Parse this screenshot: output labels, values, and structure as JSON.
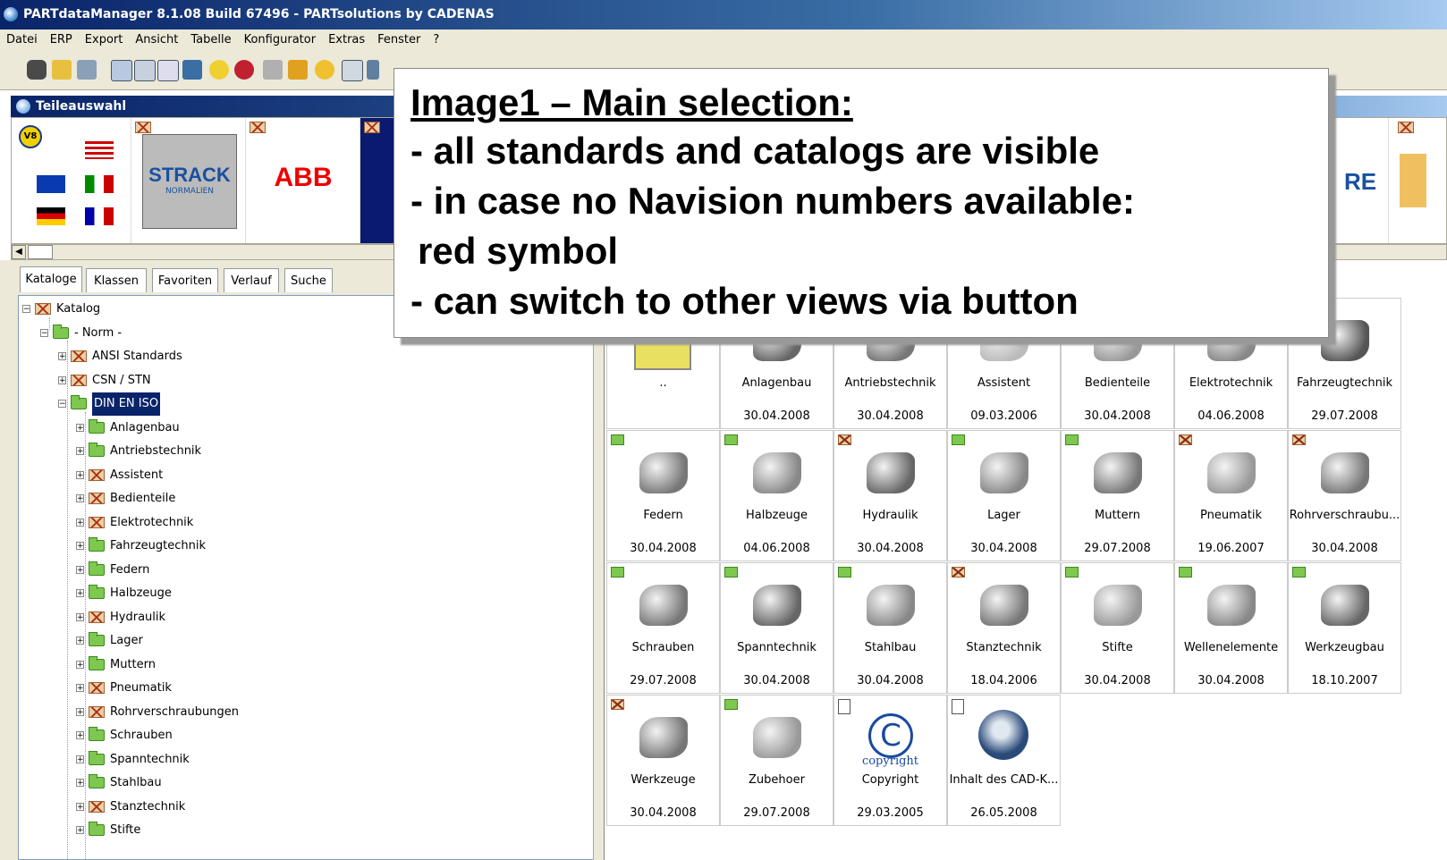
{
  "window": {
    "title": "PARTdataManager 8.1.08 Build 67496 - PARTsolutions by CADENAS"
  },
  "menu": [
    "Datei",
    "ERP",
    "Export",
    "Ansicht",
    "Tabelle",
    "Konfigurator",
    "Extras",
    "Fenster",
    "?"
  ],
  "panel": {
    "title": "Teileauswahl"
  },
  "logos": {
    "strack": "STRACK",
    "strack_sub": "NORMALIEN",
    "abb": "ABB",
    "partial_right": "RE"
  },
  "tabs": [
    "Kataloge",
    "Klassen",
    "Favoriten",
    "Verlauf",
    "Suche"
  ],
  "tree": [
    {
      "label": "Katalog",
      "icon": "red"
    },
    {
      "label": "- Norm -",
      "icon": "green"
    },
    {
      "label": "ANSI Standards",
      "icon": "red"
    },
    {
      "label": "CSN / STN",
      "icon": "red"
    },
    {
      "label": "DIN EN ISO",
      "icon": "green",
      "selected": true
    },
    {
      "label": "Anlagenbau",
      "icon": "green"
    },
    {
      "label": "Antriebstechnik",
      "icon": "green"
    },
    {
      "label": "Assistent",
      "icon": "red"
    },
    {
      "label": "Bedienteile",
      "icon": "red"
    },
    {
      "label": "Elektrotechnik",
      "icon": "red"
    },
    {
      "label": "Fahrzeugtechnik",
      "icon": "green"
    },
    {
      "label": "Federn",
      "icon": "green"
    },
    {
      "label": "Halbzeuge",
      "icon": "green"
    },
    {
      "label": "Hydraulik",
      "icon": "red"
    },
    {
      "label": "Lager",
      "icon": "green"
    },
    {
      "label": "Muttern",
      "icon": "green"
    },
    {
      "label": "Pneumatik",
      "icon": "red"
    },
    {
      "label": "Rohrverschraubungen",
      "icon": "red"
    },
    {
      "label": "Schrauben",
      "icon": "green"
    },
    {
      "label": "Spanntechnik",
      "icon": "green"
    },
    {
      "label": "Stahlbau",
      "icon": "green"
    },
    {
      "label": "Stanztechnik",
      "icon": "red"
    },
    {
      "label": "Stifte",
      "icon": "green"
    }
  ],
  "grid": [
    {
      "name": "..",
      "date": "",
      "badge": "none"
    },
    {
      "name": "Anlagenbau",
      "date": "30.04.2008",
      "badge": "none"
    },
    {
      "name": "Antriebstechnik",
      "date": "30.04.2008",
      "badge": "none"
    },
    {
      "name": "Assistent",
      "date": "09.03.2006",
      "badge": "none"
    },
    {
      "name": "Bedienteile",
      "date": "30.04.2008",
      "badge": "none"
    },
    {
      "name": "Elektrotechnik",
      "date": "04.06.2008",
      "badge": "none"
    },
    {
      "name": "Fahrzeugtechnik",
      "date": "29.07.2008",
      "badge": "none"
    },
    {
      "name": "Federn",
      "date": "30.04.2008",
      "badge": "green"
    },
    {
      "name": "Halbzeuge",
      "date": "04.06.2008",
      "badge": "green"
    },
    {
      "name": "Hydraulik",
      "date": "30.04.2008",
      "badge": "red"
    },
    {
      "name": "Lager",
      "date": "30.04.2008",
      "badge": "green"
    },
    {
      "name": "Muttern",
      "date": "29.07.2008",
      "badge": "green"
    },
    {
      "name": "Pneumatik",
      "date": "19.06.2007",
      "badge": "red"
    },
    {
      "name": "Rohrverschraubu...",
      "date": "30.04.2008",
      "badge": "red"
    },
    {
      "name": "Schrauben",
      "date": "29.07.2008",
      "badge": "green"
    },
    {
      "name": "Spanntechnik",
      "date": "30.04.2008",
      "badge": "green"
    },
    {
      "name": "Stahlbau",
      "date": "30.04.2008",
      "badge": "green"
    },
    {
      "name": "Stanztechnik",
      "date": "18.04.2006",
      "badge": "red"
    },
    {
      "name": "Stifte",
      "date": "30.04.2008",
      "badge": "green"
    },
    {
      "name": "Wellenelemente",
      "date": "30.04.2008",
      "badge": "green"
    },
    {
      "name": "Werkzeugbau",
      "date": "18.10.2007",
      "badge": "green"
    },
    {
      "name": "Werkzeuge",
      "date": "30.04.2008",
      "badge": "red"
    },
    {
      "name": "Zubehoer",
      "date": "29.07.2008",
      "badge": "green"
    },
    {
      "name": "Copyright",
      "date": "29.03.2005",
      "badge": "doc"
    },
    {
      "name": "Inhalt des CAD-K...",
      "date": "26.05.2008",
      "badge": "doc"
    }
  ],
  "copyright_text": "copyright",
  "callout": {
    "title": "Image1 – Main selection:",
    "lines": [
      "- all standards and catalogs are visible",
      "- in case no Navision numbers available:",
      "  red symbol",
      "- can switch to other views via button"
    ]
  }
}
